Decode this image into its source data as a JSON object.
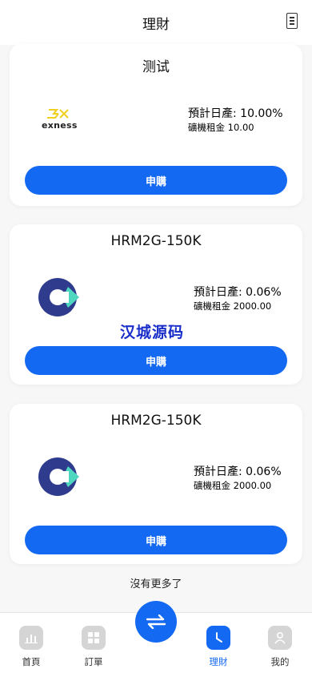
{
  "header": {
    "title": "理財"
  },
  "products": [
    {
      "title": "测试",
      "logo": "exness-logo",
      "logo_text": "exness",
      "yield_label": "預計日產:",
      "yield_value": "10.00%",
      "rent_label": "礦機租金",
      "rent_value": "10.00",
      "button_label": "申購"
    },
    {
      "title": "HRM2G-150K",
      "logo": "c-mark-logo",
      "yield_label": "預計日產:",
      "yield_value": "0.06%",
      "rent_label": "礦機租金",
      "rent_value": "2000.00",
      "button_label": "申購"
    },
    {
      "title": "HRM2G-150K",
      "logo": "c-mark-logo",
      "yield_label": "預計日產:",
      "yield_value": "0.06%",
      "rent_label": "礦機租金",
      "rent_value": "2000.00",
      "button_label": "申購"
    }
  ],
  "end_text": "沒有更多了",
  "watermark": "汉城源码",
  "tabbar": {
    "items": [
      {
        "label": "首頁",
        "icon": "bar-chart-icon",
        "active": false
      },
      {
        "label": "訂單",
        "icon": "grid-icon",
        "active": false
      },
      {
        "label": "",
        "icon": "swap-arrows-icon",
        "active": false
      },
      {
        "label": "理財",
        "icon": "clock-icon",
        "active": true
      },
      {
        "label": "我的",
        "icon": "user-icon",
        "active": false
      }
    ]
  },
  "colors": {
    "accent": "#1469f2",
    "background": "#f7f7f8",
    "card": "#ffffff",
    "inactive_icon": "#d5d5d5",
    "logo_navy": "#2f3b8c",
    "logo_teal": "#4fd6be",
    "exness_yellow": "#f0cf1e"
  }
}
